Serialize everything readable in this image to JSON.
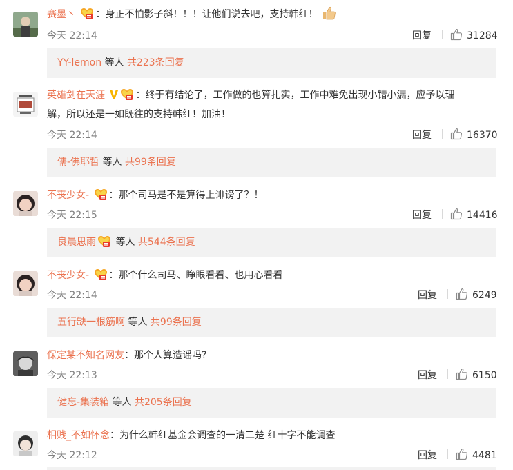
{
  "comments": [
    {
      "user": "赛墨丶",
      "text": "身正不怕影子斜！！！让他们说去吧，支持韩红！",
      "time": "今天 22:14",
      "reply_label": "回复",
      "likes": "31284",
      "replies_user": "YY-lemon",
      "replies_mid": " 等人 ",
      "replies_count": "共223条回复"
    },
    {
      "user": "英雄剑在天涯",
      "text_line1": "终于有结论了，工作做的也算扎实，工作中难免出现小错小漏，应予以理",
      "text_line2": "解，所以还是一如既往的支持韩红！加油！",
      "time": "今天 22:14",
      "reply_label": "回复",
      "likes": "16370",
      "replies_user": "儒-佛耶哲",
      "replies_mid": " 等人 ",
      "replies_count": "共99条回复"
    },
    {
      "user": "不丧少女-",
      "text": "那个司马是不是算得上诽谤了？！",
      "time": "今天 22:15",
      "reply_label": "回复",
      "likes": "14416",
      "replies_user": "良晨思雨",
      "replies_mid": " 等人 ",
      "replies_count": "共544条回复"
    },
    {
      "user": "不丧少女-",
      "text": "那个什么司马、睁眼看看、也用心看看",
      "time": "今天 22:14",
      "reply_label": "回复",
      "likes": "6249",
      "replies_user": "五行缺一根筋啊",
      "replies_mid": " 等人 ",
      "replies_count": "共99条回复"
    },
    {
      "user": "保定某不知名网友",
      "text": "那个人算造谣吗?",
      "time": "今天 22:13",
      "reply_label": "回复",
      "likes": "6150",
      "replies_user": "健忘-集装箱",
      "replies_mid": " 等人 ",
      "replies_count": "共205条回复"
    },
    {
      "user": "相贱_不如怀念",
      "text": "为什么韩红基金会调查的一清二楚 红十字不能调查",
      "time": "今天 22:12",
      "reply_label": "回复",
      "likes": "4481"
    }
  ],
  "colon": "：",
  "colors": {
    "username": "#eb7350",
    "meta": "#808080",
    "reply_box_bg": "#f2f2f2"
  }
}
